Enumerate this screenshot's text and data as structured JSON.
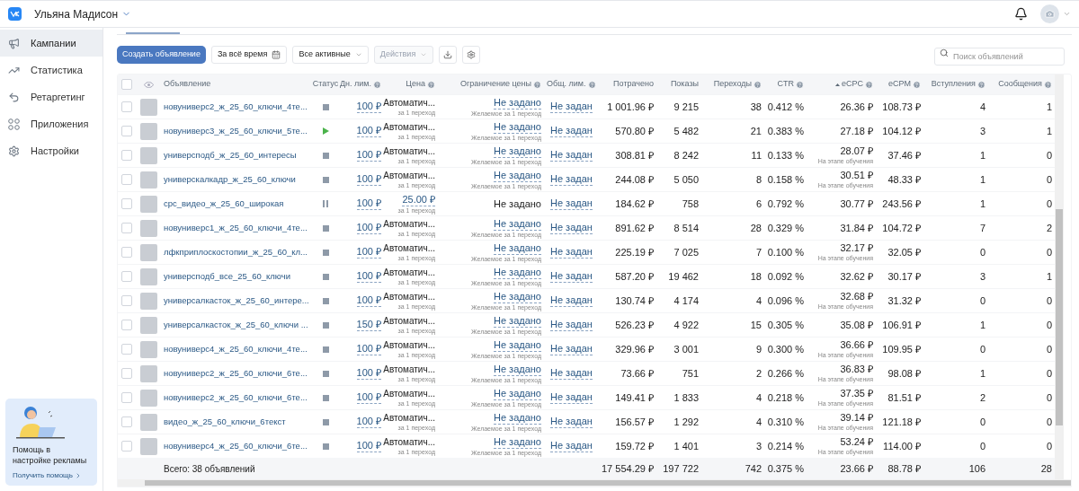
{
  "top_bar": {
    "account_name": "Ульяна Мадисон"
  },
  "sidebar": {
    "items": [
      {
        "label": "Кампании",
        "selected": true
      },
      {
        "label": "Статистика",
        "selected": false
      },
      {
        "label": "Ретаргетинг",
        "selected": false
      },
      {
        "label": "Приложения",
        "selected": false
      },
      {
        "label": "Настройки",
        "selected": false
      }
    ]
  },
  "help_card": {
    "title": "Помощь в настройке рекламы",
    "link": "Получить помощь"
  },
  "toolbar": {
    "create_button": "Создать объявление",
    "period": "За всё время",
    "filter": "Все активные",
    "actions": {
      "label": "Действия",
      "disabled": true
    },
    "search": {
      "placeholder": "Поиск объявлений"
    }
  },
  "table": {
    "all_selected": false,
    "columns": [
      {
        "label": "Объявление",
        "help": false,
        "sorted": false
      },
      {
        "label": "Статус",
        "help": false,
        "sorted": false
      },
      {
        "label": "Дн. лим.",
        "help": true,
        "sorted": false
      },
      {
        "label": "Цена",
        "help": true,
        "sorted": false
      },
      {
        "label": "Ограничение цены",
        "help": true,
        "sorted": false
      },
      {
        "label": "Общ. лим.",
        "help": true,
        "sorted": false
      },
      {
        "label": "Потрачено",
        "help": false,
        "sorted": false
      },
      {
        "label": "Показы",
        "help": false,
        "sorted": false
      },
      {
        "label": "Переходы",
        "help": true,
        "sorted": false
      },
      {
        "label": "CTR",
        "help": true,
        "sorted": false
      },
      {
        "label": "eCPC",
        "help": true,
        "sorted": true
      },
      {
        "label": "eCPM",
        "help": true,
        "sorted": false
      },
      {
        "label": "Вступления",
        "help": true,
        "sorted": false
      },
      {
        "label": "Сообщения",
        "help": true,
        "sorted": false
      }
    ],
    "rows": [
      {
        "selected": false,
        "name": "новуниверс2_ж_25_60_ключи_4те...",
        "status": {
          "kind": "stopped"
        },
        "daily_limit": "100 ₽",
        "price": {
          "kind": "auto",
          "text": "Автоматич..."
        },
        "price_note": "за 1 переход",
        "price_limit": "Не задано",
        "price_limit_note": "Желаемое за 1 переход",
        "total_limit": "Не задан",
        "spent": "1 001.96 ₽",
        "impressions": "9 215",
        "clicks": "38",
        "ctr": "0.412 %",
        "ecpc": "26.36 ₽",
        "ecpm": "108.73 ₽",
        "joins": "4",
        "messages": "1"
      },
      {
        "selected": false,
        "name": "новуниверс3_ж_25_60_ключи_5те...",
        "status": {
          "kind": "active"
        },
        "daily_limit": "100 ₽",
        "price": {
          "kind": "auto",
          "text": "Автоматич..."
        },
        "price_note": "за 1 переход",
        "price_limit": "Не задано",
        "price_limit_note": "Желаемое за 1 переход",
        "total_limit": "Не задан",
        "spent": "570.80 ₽",
        "impressions": "5 482",
        "clicks": "21",
        "ctr": "0.383 %",
        "ecpc": "27.18 ₽",
        "ecpm": "104.12 ₽",
        "joins": "3",
        "messages": "1"
      },
      {
        "selected": false,
        "name": "универсподб_ж_25_60_интересы",
        "status": {
          "kind": "stopped"
        },
        "daily_limit": "100 ₽",
        "price": {
          "kind": "auto",
          "text": "Автоматич..."
        },
        "price_note": "за 1 переход",
        "price_limit": "Не задано",
        "price_limit_note": "Желаемое за 1 переход",
        "total_limit": "Не задан",
        "spent": "308.81 ₽",
        "impressions": "8 242",
        "clicks": "11",
        "ctr": "0.133 %",
        "ecpc": "28.07 ₽",
        "ecpc_note": "На этапе обучения",
        "ecpm": "37.46 ₽",
        "joins": "1",
        "messages": "0"
      },
      {
        "selected": false,
        "name": "универскалкадр_ж_25_60_ключи",
        "status": {
          "kind": "stopped"
        },
        "daily_limit": "100 ₽",
        "price": {
          "kind": "auto",
          "text": "Автоматич..."
        },
        "price_note": "за 1 переход",
        "price_limit": "Не задано",
        "price_limit_note": "Желаемое за 1 переход",
        "total_limit": "Не задан",
        "spent": "244.08 ₽",
        "impressions": "5 050",
        "clicks": "8",
        "ctr": "0.158 %",
        "ecpc": "30.51 ₽",
        "ecpc_note": "На этапе обучения",
        "ecpm": "48.33 ₽",
        "joins": "1",
        "messages": "0"
      },
      {
        "selected": false,
        "name": "срс_видео_ж_25_60_широкая",
        "status": {
          "kind": "paused"
        },
        "daily_limit": "100 ₽",
        "price": {
          "kind": "fixed",
          "text": "25.00 ₽"
        },
        "price_note": "за 1 переход",
        "price_limit": "Не задано",
        "total_limit": "Не задан",
        "spent": "184.62 ₽",
        "impressions": "758",
        "clicks": "6",
        "ctr": "0.792 %",
        "ecpc": "30.77 ₽",
        "ecpm": "243.56 ₽",
        "joins": "1",
        "messages": "0"
      },
      {
        "selected": false,
        "name": "новуниверс1_ж_25_60_ключи_4те...",
        "status": {
          "kind": "stopped"
        },
        "daily_limit": "100 ₽",
        "price": {
          "kind": "auto",
          "text": "Автоматич..."
        },
        "price_note": "за 1 переход",
        "price_limit": "Не задано",
        "price_limit_note": "Желаемое за 1 переход",
        "total_limit": "Не задан",
        "spent": "891.62 ₽",
        "impressions": "8 514",
        "clicks": "28",
        "ctr": "0.329 %",
        "ecpc": "31.84 ₽",
        "ecpm": "104.72 ₽",
        "joins": "7",
        "messages": "2"
      },
      {
        "selected": false,
        "name": "лфкприплоскостопии_ж_25_60_кл...",
        "status": {
          "kind": "stopped"
        },
        "daily_limit": "100 ₽",
        "price": {
          "kind": "auto",
          "text": "Автоматич..."
        },
        "price_note": "за 1 переход",
        "price_limit": "Не задано",
        "price_limit_note": "Желаемое за 1 переход",
        "total_limit": "Не задан",
        "spent": "225.19 ₽",
        "impressions": "7 025",
        "clicks": "7",
        "ctr": "0.100 %",
        "ecpc": "32.17 ₽",
        "ecpc_note": "На этапе обучения",
        "ecpm": "32.05 ₽",
        "joins": "0",
        "messages": "0"
      },
      {
        "selected": false,
        "name": "универсподб_все_25_60_ключи",
        "status": {
          "kind": "stopped"
        },
        "daily_limit": "100 ₽",
        "price": {
          "kind": "auto",
          "text": "Автоматич..."
        },
        "price_note": "за 1 переход",
        "price_limit": "Не задано",
        "price_limit_note": "Желаемое за 1 переход",
        "total_limit": "Не задан",
        "spent": "587.20 ₽",
        "impressions": "19 462",
        "clicks": "18",
        "ctr": "0.092 %",
        "ecpc": "32.62 ₽",
        "ecpm": "30.17 ₽",
        "joins": "3",
        "messages": "1"
      },
      {
        "selected": false,
        "name": "универсалкасток_ж_25_60_интере...",
        "status": {
          "kind": "stopped"
        },
        "daily_limit": "100 ₽",
        "price": {
          "kind": "auto",
          "text": "Автоматич..."
        },
        "price_note": "за 1 переход",
        "price_limit": "Не задано",
        "price_limit_note": "Желаемое за 1 переход",
        "total_limit": "Не задан",
        "spent": "130.74 ₽",
        "impressions": "4 174",
        "clicks": "4",
        "ctr": "0.096 %",
        "ecpc": "32.68 ₽",
        "ecpc_note": "На этапе обучения",
        "ecpm": "31.32 ₽",
        "joins": "0",
        "messages": "0"
      },
      {
        "selected": false,
        "name": "универсалкасток_ж_25_60_ключи ...",
        "status": {
          "kind": "stopped"
        },
        "daily_limit": "150 ₽",
        "price": {
          "kind": "auto",
          "text": "Автоматич..."
        },
        "price_note": "за 1 переход",
        "price_limit": "Не задано",
        "price_limit_note": "Желаемое за 1 переход",
        "total_limit": "Не задан",
        "spent": "526.23 ₽",
        "impressions": "4 922",
        "clicks": "15",
        "ctr": "0.305 %",
        "ecpc": "35.08 ₽",
        "ecpm": "106.91 ₽",
        "joins": "1",
        "messages": "0"
      },
      {
        "selected": false,
        "name": "новуниверс4_ж_25_60_ключи_4те...",
        "status": {
          "kind": "stopped"
        },
        "daily_limit": "100 ₽",
        "price": {
          "kind": "auto",
          "text": "Автоматич..."
        },
        "price_note": "за 1 переход",
        "price_limit": "Не задано",
        "price_limit_note": "Желаемое за 1 переход",
        "total_limit": "Не задан",
        "spent": "329.96 ₽",
        "impressions": "3 001",
        "clicks": "9",
        "ctr": "0.300 %",
        "ecpc": "36.66 ₽",
        "ecpc_note": "На этапе обучения",
        "ecpm": "109.95 ₽",
        "joins": "0",
        "messages": "0"
      },
      {
        "selected": false,
        "name": "новуниверс2_ж_25_60_ключи_6те...",
        "status": {
          "kind": "stopped"
        },
        "daily_limit": "100 ₽",
        "price": {
          "kind": "auto",
          "text": "Автоматич..."
        },
        "price_note": "за 1 переход",
        "price_limit": "Не задано",
        "price_limit_note": "Желаемое за 1 переход",
        "total_limit": "Не задан",
        "spent": "73.66 ₽",
        "impressions": "751",
        "clicks": "2",
        "ctr": "0.266 %",
        "ecpc": "36.83 ₽",
        "ecpc_note": "На этапе обучения",
        "ecpm": "98.08 ₽",
        "joins": "1",
        "messages": "0"
      },
      {
        "selected": false,
        "name": "новуниверс2_ж_25_60_ключи_6те...",
        "status": {
          "kind": "stopped"
        },
        "daily_limit": "100 ₽",
        "price": {
          "kind": "auto",
          "text": "Автоматич..."
        },
        "price_note": "за 1 переход",
        "price_limit": "Не задано",
        "price_limit_note": "Желаемое за 1 переход",
        "total_limit": "Не задан",
        "spent": "149.41 ₽",
        "impressions": "1 833",
        "clicks": "4",
        "ctr": "0.218 %",
        "ecpc": "37.35 ₽",
        "ecpc_note": "На этапе обучения",
        "ecpm": "81.51 ₽",
        "joins": "2",
        "messages": "0"
      },
      {
        "selected": false,
        "name": "видео_ж_25_60_ключи_6текст",
        "status": {
          "kind": "stopped"
        },
        "daily_limit": "100 ₽",
        "price": {
          "kind": "auto",
          "text": "Автоматич..."
        },
        "price_note": "за 1 переход",
        "price_limit": "Не задано",
        "price_limit_note": "Желаемое за 1 переход",
        "total_limit": "Не задан",
        "spent": "156.57 ₽",
        "impressions": "1 292",
        "clicks": "4",
        "ctr": "0.310 %",
        "ecpc": "39.14 ₽",
        "ecpc_note": "На этапе обучения",
        "ecpm": "121.18 ₽",
        "joins": "0",
        "messages": "0"
      },
      {
        "selected": false,
        "name": "новуниверс4_ж_25_60_ключи_6те...",
        "status": {
          "kind": "stopped"
        },
        "daily_limit": "100 ₽",
        "price": {
          "kind": "auto",
          "text": "Автоматич..."
        },
        "price_note": "за 1 переход",
        "price_limit": "Не задано",
        "price_limit_note": "Желаемое за 1 переход",
        "total_limit": "Не задан",
        "spent": "159.72 ₽",
        "impressions": "1 401",
        "clicks": "3",
        "ctr": "0.214 %",
        "ecpc": "53.24 ₽",
        "ecpc_note": "На этапе обучения",
        "ecpm": "114.00 ₽",
        "joins": "0",
        "messages": "0"
      }
    ],
    "total": {
      "label": "Всего: 38 объявлений",
      "spent": "17 554.29 ₽",
      "impressions": "197 722",
      "clicks": "742",
      "ctr": "0.375 %",
      "ecpc": "23.66 ₽",
      "ecpm": "88.78 ₽",
      "joins": "106",
      "messages": "28"
    }
  }
}
